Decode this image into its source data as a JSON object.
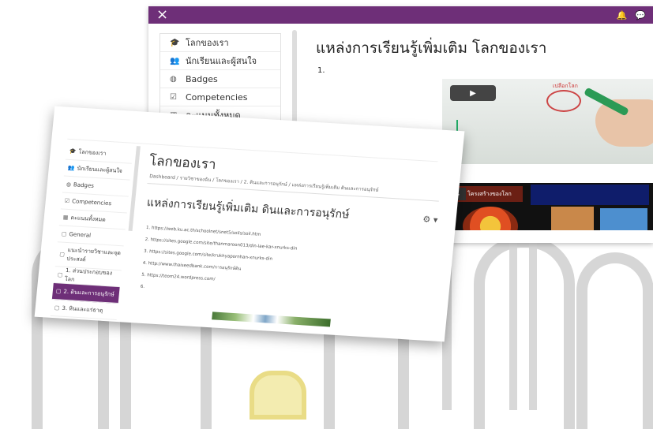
{
  "back_window": {
    "close_icon": "×",
    "topbar_icons": [
      "bell-icon",
      "chat-icon"
    ],
    "nav": [
      {
        "icon": "graduation-cap-icon",
        "glyph": "🎓",
        "label": "โลกของเรา"
      },
      {
        "icon": "users-icon",
        "glyph": "👥",
        "label": "นักเรียนและผู้สนใจ"
      },
      {
        "icon": "badge-icon",
        "glyph": "◍",
        "label": "Badges"
      },
      {
        "icon": "checkbox-icon",
        "glyph": "☑",
        "label": "Competencies"
      },
      {
        "icon": "table-icon",
        "glyph": "▦",
        "label": "คะแนนทั้งหมด"
      }
    ],
    "heading": "แหล่งการเรียนรู้เพิ่มเติม โลกของเรา",
    "item_number": "1.",
    "video1": {
      "play": "▶",
      "annotation": "เปลือกโลก"
    },
    "video2": {
      "play": "▶",
      "title": "โครงสร้างของโลก"
    }
  },
  "front_window": {
    "sidebar": [
      {
        "icon": "graduation-cap-icon",
        "glyph": "🎓",
        "label": "โลกของเรา"
      },
      {
        "icon": "users-icon",
        "glyph": "👥",
        "label": "นักเรียนและผู้สนใจ"
      },
      {
        "icon": "badge-icon",
        "glyph": "◍",
        "label": "Badges"
      },
      {
        "icon": "checkbox-icon",
        "glyph": "☑",
        "label": "Competencies"
      },
      {
        "icon": "table-icon",
        "glyph": "▦",
        "label": "คะแนนทั้งหมด"
      },
      {
        "icon": "folder-icon",
        "glyph": "▢",
        "label": "General"
      },
      {
        "icon": "folder-icon",
        "glyph": "▢",
        "label": "แนะนำรายวิชาและจุดประสงค์"
      },
      {
        "icon": "folder-icon",
        "glyph": "▢",
        "label": "1. ส่วนประกอบของโลก"
      },
      {
        "icon": "folder-icon",
        "glyph": "▢",
        "label": "2. ดินและการอนุรักษ์"
      },
      {
        "icon": "folder-icon",
        "glyph": "▢",
        "label": "3. หินและแร่ธาตุ"
      }
    ],
    "title": "โลกของเรา",
    "breadcrumb": "Dashboard / รายวิชาของฉัน / โลกของเรา / 2. ดินและการอนุรักษ์ / แหล่งการเรียนรู้เพิ่มเติม ดินและการอนุรักษ์",
    "heading": "แหล่งการเรียนรู้เพิ่มเติม ดินและการอนุรักษ์",
    "settings_icon": "⚙ ▾",
    "links": [
      "1. https://web.ku.ac.th/schoolnet/snet5/soils/soil.htm",
      "2. https://sites.google.com/site/thanmaroon013/din-lae-kar-xnurks-din",
      "3. https://sites.google.com/site/krukhyapornhan-xnurks-din",
      "4. http://www.thaiseedbank.com/การอนุรักษ์ดิน",
      "5. https://teom24.wordpress.com/",
      "6."
    ]
  }
}
